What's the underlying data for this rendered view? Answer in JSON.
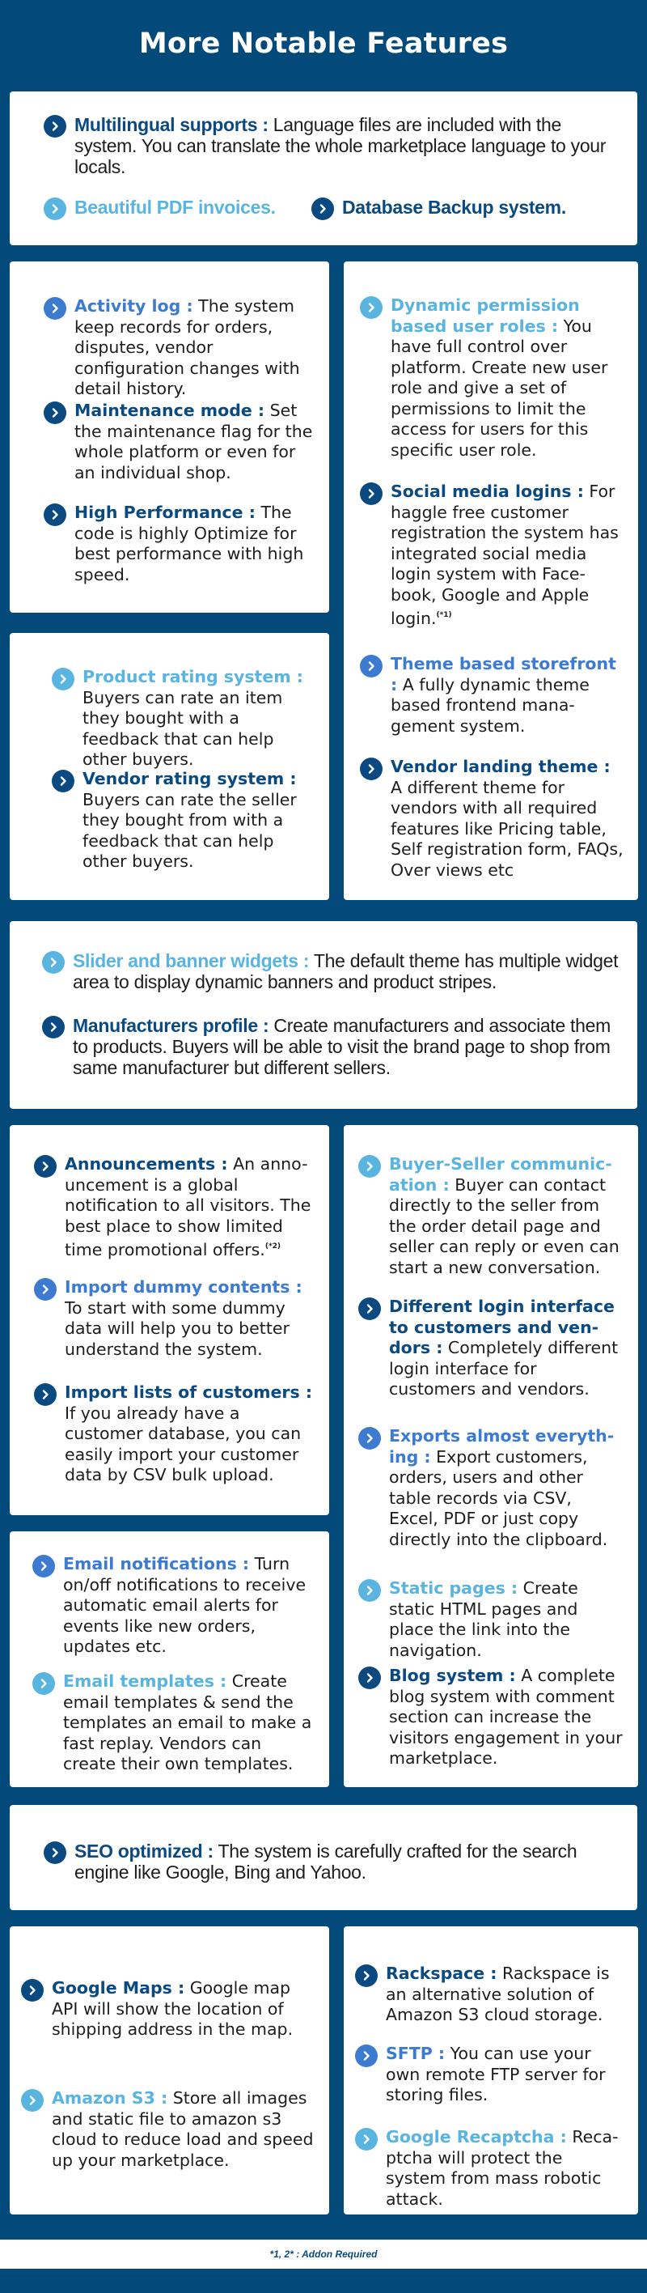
{
  "title": "More Notable Features",
  "colors": {
    "background": "#034a7b",
    "navy": "#0a4a80",
    "blue": "#3d7bd0",
    "sky": "#5ab4e0",
    "card": "#ffffff"
  },
  "card1": {
    "multilingual": {
      "heading": "Multilingual supports :",
      "text": " Language files are included with the system. You can translate the whole marketplace language to your locals."
    },
    "pdf": {
      "heading": "Beautiful PDF invoices."
    },
    "backup": {
      "heading": "Database Backup system."
    }
  },
  "left1": [
    {
      "heading": "Activity log :",
      "text": " The system keep records for orders, disputes, vendor configuration changes with detail history."
    },
    {
      "heading": "Maintenance mode :",
      "text": " Set the maintenance flag for the whole platform or even for an individual shop."
    },
    {
      "heading": "High Performance :",
      "text": " The code is highly Optimize for best performance with high speed."
    }
  ],
  "left2": [
    {
      "heading": "Product rating system :",
      "text": " Buyers can rate an item they bought with a feedback that can help other buyers."
    },
    {
      "heading": "Vendor rating system :",
      "text": " Buyers can rate the seller they bought from with a feedback that can help other buyers."
    }
  ],
  "right1": [
    {
      "heading": "Dynamic permission based user roles :",
      "text": " You have full control over platform. Create new user role and give a set of permissions to limit the access for users for this specific user role."
    },
    {
      "heading": "Social media logins :",
      "text": " For haggle free customer registration the system has integrated social media login system with Face-book, Google and Apple login.",
      "note": "(*1)"
    },
    {
      "heading": "Theme based storefront :",
      "text": " A fully dynamic theme based frontend mana-gement system."
    },
    {
      "heading": "Vendor landing theme :",
      "text": " A different theme for vendors with all required features like Pricing table, Self registration form, FAQs, Over views etc"
    }
  ],
  "wide1": [
    {
      "heading": "Slider and banner widgets :",
      "text": " The default theme has multiple widget area to display dynamic banners and product stripes."
    },
    {
      "heading": "Manufacturers profile :",
      "text": " Create manufacturers and associate them to products. Buyers will be able to visit the brand page to shop from same manufacturer but different sellers."
    }
  ],
  "left3": [
    {
      "heading": "Announcements :",
      "text": " An anno-uncement is a global notification to all visitors. The best place to show limited time promotional offers.",
      "note": "(*2)"
    },
    {
      "heading": "Import dummy contents :",
      "text": " To start with some dummy data will help you to better understand the system."
    },
    {
      "heading": "Import lists of customers :",
      "text": " If you already have a customer database, you can easily import your customer data by CSV bulk upload."
    }
  ],
  "left4": [
    {
      "heading": "Email notifications :",
      "text": " Turn on/off notifications to receive automatic email alerts for events like new orders, updates etc."
    },
    {
      "heading": "Email templates :",
      "text": " Create email templates & send the templates an email to make a fast replay. Vendors can create their own templates."
    }
  ],
  "right2": [
    {
      "heading": "Buyer-Seller communic-ation :",
      "text": " Buyer can contact directly to the seller from the order detail page and seller can reply or even can start a new conversation."
    },
    {
      "heading": "Different login interface to customers and ven-dors :",
      "text": " Completely different login interface for customers and vendors."
    },
    {
      "heading": "Exports almost everyth-ing :",
      "text": " Export customers, orders, users and other table records via CSV, Excel, PDF or just copy directly into the clipboard."
    },
    {
      "heading": "Static pages :",
      "text": " Create static HTML pages and place the link into the navigation."
    },
    {
      "heading": "Blog system :",
      "text": " A complete blog system with comment section can increase the visitors engagement in your marketplace."
    }
  ],
  "wide2": [
    {
      "heading": "SEO optimized :",
      "text": " The system is carefully crafted for the search engine like Google, Bing and Yahoo."
    }
  ],
  "left5": [
    {
      "heading": "Google Maps :",
      "text": " Google map API will show the location of shipping address in the map."
    },
    {
      "heading": "Amazon S3 :",
      "text": " Store all images and static file to amazon s3 cloud to reduce load and speed up your marketplace."
    }
  ],
  "right3": [
    {
      "heading": "Rackspace :",
      "text": " Rackspace is an alternative solution of Amazon S3 cloud storage."
    },
    {
      "heading": "SFTP :",
      "text": " You can use your own remote FTP server for storing files."
    },
    {
      "heading": "Google Recaptcha :",
      "text": " Reca-ptcha will protect the system from mass robotic attack."
    }
  ],
  "footer": {
    "note": "*1, 2* : Addon Required"
  },
  "icons": {
    "bullet": "chevron-right-circle-icon"
  }
}
